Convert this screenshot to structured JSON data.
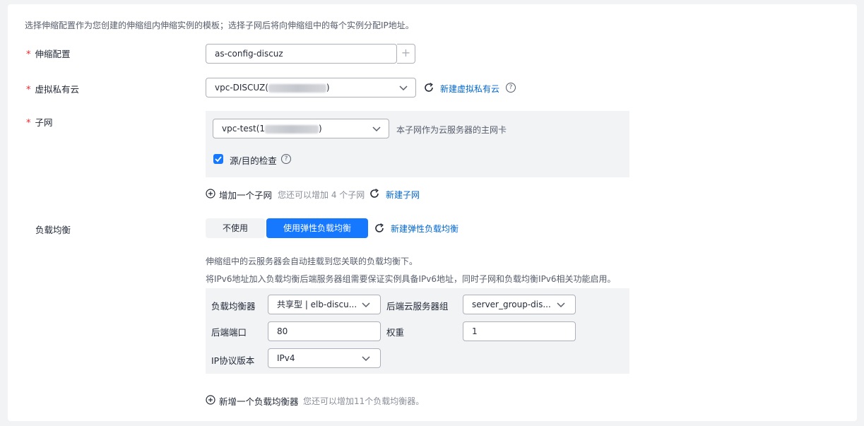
{
  "intro": "选择伸缩配置作为您创建的伸缩组内伸缩实例的模板；选择子网后将向伸缩组中的每个实例分配IP地址。",
  "required_mark": "*",
  "scaling_config": {
    "label": "伸缩配置",
    "value": "as-config-discuz",
    "add_glyph": "+"
  },
  "vpc": {
    "label": "虚拟私有云",
    "value_prefix": "vpc-DISCUZ(",
    "value_suffix": ")",
    "create_link": "新建虚拟私有云",
    "help_glyph": "?"
  },
  "subnet": {
    "label": "子网",
    "value_prefix": "vpc-test(1",
    "value_suffix": ")",
    "hint": "本子网作为云服务器的主网卡",
    "source_check_label": "源/目的检查",
    "source_check_checked": true,
    "help_glyph": "?",
    "add_label": "增加一个子网",
    "add_remaining": "您还可以增加 4 个子网",
    "create_link": "新建子网"
  },
  "load_balance": {
    "label": "负载均衡",
    "option_off": "不使用",
    "option_on": "使用弹性负载均衡",
    "create_link": "新建弹性负载均衡",
    "note1": "伸缩组中的云服务器会自动挂载到您关联的负载均衡下。",
    "note2": "将IPv6地址加入负载均衡后端服务器组需要保证实例具备IPv6地址，同时子网和负载均衡IPv6相关功能启用。",
    "balancer_label": "负载均衡器",
    "balancer_value": "共享型 | elb-discu...",
    "server_group_label": "后端云服务器组",
    "server_group_value": "server_group-dis...",
    "port_label": "后端端口",
    "port_value": "80",
    "weight_label": "权重",
    "weight_value": "1",
    "ip_version_label": "IP协议版本",
    "ip_version_value": "IPv4",
    "add_label": "新增一个负载均衡器",
    "add_remaining": "您还可以增加11个负载均衡器。"
  },
  "colors": {
    "accent": "#1677ff",
    "link": "#0067d1",
    "required": "#f5222d"
  }
}
